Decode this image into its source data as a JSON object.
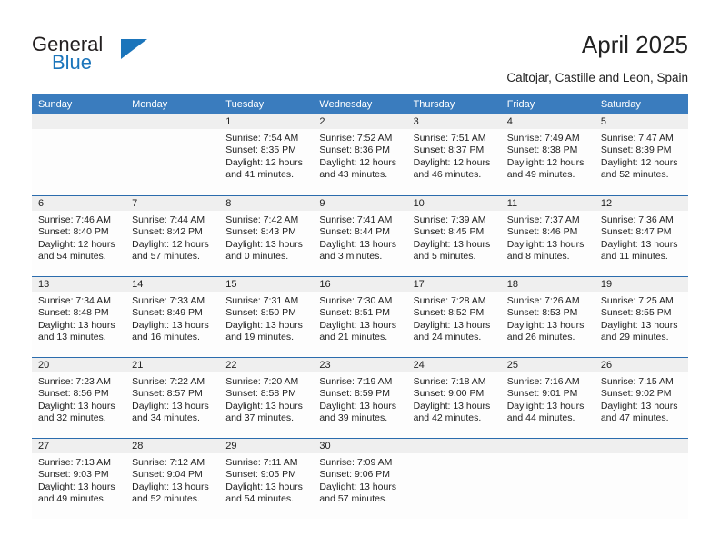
{
  "brand": {
    "name_part1": "General",
    "name_part2": "Blue",
    "accent_color": "#1b75bb"
  },
  "header": {
    "title": "April 2025",
    "subtitle": "Caltojar, Castille and Leon, Spain"
  },
  "calendar": {
    "header_bg": "#3a7cbe",
    "weekday_headers": [
      "Sunday",
      "Monday",
      "Tuesday",
      "Wednesday",
      "Thursday",
      "Friday",
      "Saturday"
    ],
    "weeks": [
      [
        {
          "day": "",
          "sunrise": "",
          "sunset": "",
          "daylight_line1": "",
          "daylight_line2": ""
        },
        {
          "day": "",
          "sunrise": "",
          "sunset": "",
          "daylight_line1": "",
          "daylight_line2": ""
        },
        {
          "day": "1",
          "sunrise": "Sunrise: 7:54 AM",
          "sunset": "Sunset: 8:35 PM",
          "daylight_line1": "Daylight: 12 hours",
          "daylight_line2": "and 41 minutes."
        },
        {
          "day": "2",
          "sunrise": "Sunrise: 7:52 AM",
          "sunset": "Sunset: 8:36 PM",
          "daylight_line1": "Daylight: 12 hours",
          "daylight_line2": "and 43 minutes."
        },
        {
          "day": "3",
          "sunrise": "Sunrise: 7:51 AM",
          "sunset": "Sunset: 8:37 PM",
          "daylight_line1": "Daylight: 12 hours",
          "daylight_line2": "and 46 minutes."
        },
        {
          "day": "4",
          "sunrise": "Sunrise: 7:49 AM",
          "sunset": "Sunset: 8:38 PM",
          "daylight_line1": "Daylight: 12 hours",
          "daylight_line2": "and 49 minutes."
        },
        {
          "day": "5",
          "sunrise": "Sunrise: 7:47 AM",
          "sunset": "Sunset: 8:39 PM",
          "daylight_line1": "Daylight: 12 hours",
          "daylight_line2": "and 52 minutes."
        }
      ],
      [
        {
          "day": "6",
          "sunrise": "Sunrise: 7:46 AM",
          "sunset": "Sunset: 8:40 PM",
          "daylight_line1": "Daylight: 12 hours",
          "daylight_line2": "and 54 minutes."
        },
        {
          "day": "7",
          "sunrise": "Sunrise: 7:44 AM",
          "sunset": "Sunset: 8:42 PM",
          "daylight_line1": "Daylight: 12 hours",
          "daylight_line2": "and 57 minutes."
        },
        {
          "day": "8",
          "sunrise": "Sunrise: 7:42 AM",
          "sunset": "Sunset: 8:43 PM",
          "daylight_line1": "Daylight: 13 hours",
          "daylight_line2": "and 0 minutes."
        },
        {
          "day": "9",
          "sunrise": "Sunrise: 7:41 AM",
          "sunset": "Sunset: 8:44 PM",
          "daylight_line1": "Daylight: 13 hours",
          "daylight_line2": "and 3 minutes."
        },
        {
          "day": "10",
          "sunrise": "Sunrise: 7:39 AM",
          "sunset": "Sunset: 8:45 PM",
          "daylight_line1": "Daylight: 13 hours",
          "daylight_line2": "and 5 minutes."
        },
        {
          "day": "11",
          "sunrise": "Sunrise: 7:37 AM",
          "sunset": "Sunset: 8:46 PM",
          "daylight_line1": "Daylight: 13 hours",
          "daylight_line2": "and 8 minutes."
        },
        {
          "day": "12",
          "sunrise": "Sunrise: 7:36 AM",
          "sunset": "Sunset: 8:47 PM",
          "daylight_line1": "Daylight: 13 hours",
          "daylight_line2": "and 11 minutes."
        }
      ],
      [
        {
          "day": "13",
          "sunrise": "Sunrise: 7:34 AM",
          "sunset": "Sunset: 8:48 PM",
          "daylight_line1": "Daylight: 13 hours",
          "daylight_line2": "and 13 minutes."
        },
        {
          "day": "14",
          "sunrise": "Sunrise: 7:33 AM",
          "sunset": "Sunset: 8:49 PM",
          "daylight_line1": "Daylight: 13 hours",
          "daylight_line2": "and 16 minutes."
        },
        {
          "day": "15",
          "sunrise": "Sunrise: 7:31 AM",
          "sunset": "Sunset: 8:50 PM",
          "daylight_line1": "Daylight: 13 hours",
          "daylight_line2": "and 19 minutes."
        },
        {
          "day": "16",
          "sunrise": "Sunrise: 7:30 AM",
          "sunset": "Sunset: 8:51 PM",
          "daylight_line1": "Daylight: 13 hours",
          "daylight_line2": "and 21 minutes."
        },
        {
          "day": "17",
          "sunrise": "Sunrise: 7:28 AM",
          "sunset": "Sunset: 8:52 PM",
          "daylight_line1": "Daylight: 13 hours",
          "daylight_line2": "and 24 minutes."
        },
        {
          "day": "18",
          "sunrise": "Sunrise: 7:26 AM",
          "sunset": "Sunset: 8:53 PM",
          "daylight_line1": "Daylight: 13 hours",
          "daylight_line2": "and 26 minutes."
        },
        {
          "day": "19",
          "sunrise": "Sunrise: 7:25 AM",
          "sunset": "Sunset: 8:55 PM",
          "daylight_line1": "Daylight: 13 hours",
          "daylight_line2": "and 29 minutes."
        }
      ],
      [
        {
          "day": "20",
          "sunrise": "Sunrise: 7:23 AM",
          "sunset": "Sunset: 8:56 PM",
          "daylight_line1": "Daylight: 13 hours",
          "daylight_line2": "and 32 minutes."
        },
        {
          "day": "21",
          "sunrise": "Sunrise: 7:22 AM",
          "sunset": "Sunset: 8:57 PM",
          "daylight_line1": "Daylight: 13 hours",
          "daylight_line2": "and 34 minutes."
        },
        {
          "day": "22",
          "sunrise": "Sunrise: 7:20 AM",
          "sunset": "Sunset: 8:58 PM",
          "daylight_line1": "Daylight: 13 hours",
          "daylight_line2": "and 37 minutes."
        },
        {
          "day": "23",
          "sunrise": "Sunrise: 7:19 AM",
          "sunset": "Sunset: 8:59 PM",
          "daylight_line1": "Daylight: 13 hours",
          "daylight_line2": "and 39 minutes."
        },
        {
          "day": "24",
          "sunrise": "Sunrise: 7:18 AM",
          "sunset": "Sunset: 9:00 PM",
          "daylight_line1": "Daylight: 13 hours",
          "daylight_line2": "and 42 minutes."
        },
        {
          "day": "25",
          "sunrise": "Sunrise: 7:16 AM",
          "sunset": "Sunset: 9:01 PM",
          "daylight_line1": "Daylight: 13 hours",
          "daylight_line2": "and 44 minutes."
        },
        {
          "day": "26",
          "sunrise": "Sunrise: 7:15 AM",
          "sunset": "Sunset: 9:02 PM",
          "daylight_line1": "Daylight: 13 hours",
          "daylight_line2": "and 47 minutes."
        }
      ],
      [
        {
          "day": "27",
          "sunrise": "Sunrise: 7:13 AM",
          "sunset": "Sunset: 9:03 PM",
          "daylight_line1": "Daylight: 13 hours",
          "daylight_line2": "and 49 minutes."
        },
        {
          "day": "28",
          "sunrise": "Sunrise: 7:12 AM",
          "sunset": "Sunset: 9:04 PM",
          "daylight_line1": "Daylight: 13 hours",
          "daylight_line2": "and 52 minutes."
        },
        {
          "day": "29",
          "sunrise": "Sunrise: 7:11 AM",
          "sunset": "Sunset: 9:05 PM",
          "daylight_line1": "Daylight: 13 hours",
          "daylight_line2": "and 54 minutes."
        },
        {
          "day": "30",
          "sunrise": "Sunrise: 7:09 AM",
          "sunset": "Sunset: 9:06 PM",
          "daylight_line1": "Daylight: 13 hours",
          "daylight_line2": "and 57 minutes."
        },
        {
          "day": "",
          "sunrise": "",
          "sunset": "",
          "daylight_line1": "",
          "daylight_line2": ""
        },
        {
          "day": "",
          "sunrise": "",
          "sunset": "",
          "daylight_line1": "",
          "daylight_line2": ""
        },
        {
          "day": "",
          "sunrise": "",
          "sunset": "",
          "daylight_line1": "",
          "daylight_line2": ""
        }
      ]
    ]
  }
}
